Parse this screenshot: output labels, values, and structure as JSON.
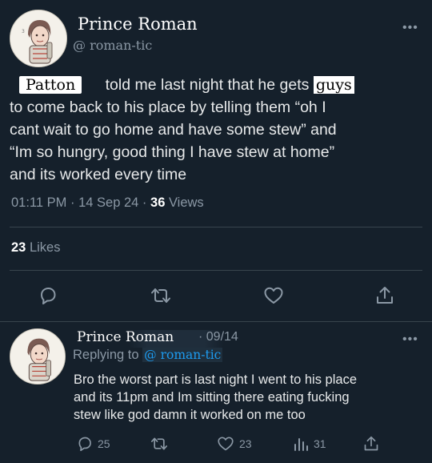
{
  "tweet": {
    "display_name": "Prince Roman",
    "handle": "@ roman-tic",
    "text_name": "Patton",
    "text_part1": "told me last night that he gets",
    "text_guys": "guys",
    "text_line2": "to come back to his place by telling them “oh I",
    "text_line3": "cant wait to go home and have some stew” and",
    "text_line4": "“Im so hungry, good thing I have stew at home”",
    "text_line5": "and its worked every time",
    "time": "01:11 PM",
    "date": "14 Sep 24",
    "views_count": "36",
    "views_label": "Views",
    "likes_count": "23",
    "likes_label": "Likes",
    "more": "•••"
  },
  "reply": {
    "display_name": "Prince Roman",
    "date": "· 09/14",
    "replying_label": "Replying to",
    "replying_handle": "@ roman-tic",
    "line1": "Bro the worst part is last night I went to his place",
    "line2": "and its 11pm and Im sitting there eating fucking",
    "line3": "stew like god damn it worked on me too",
    "replies": "25",
    "likes": "23",
    "views": "31",
    "more": "•••"
  },
  "icons": [
    "reply-icon",
    "retweet-icon",
    "like-icon",
    "share-icon",
    "views-icon",
    "more-icon"
  ]
}
